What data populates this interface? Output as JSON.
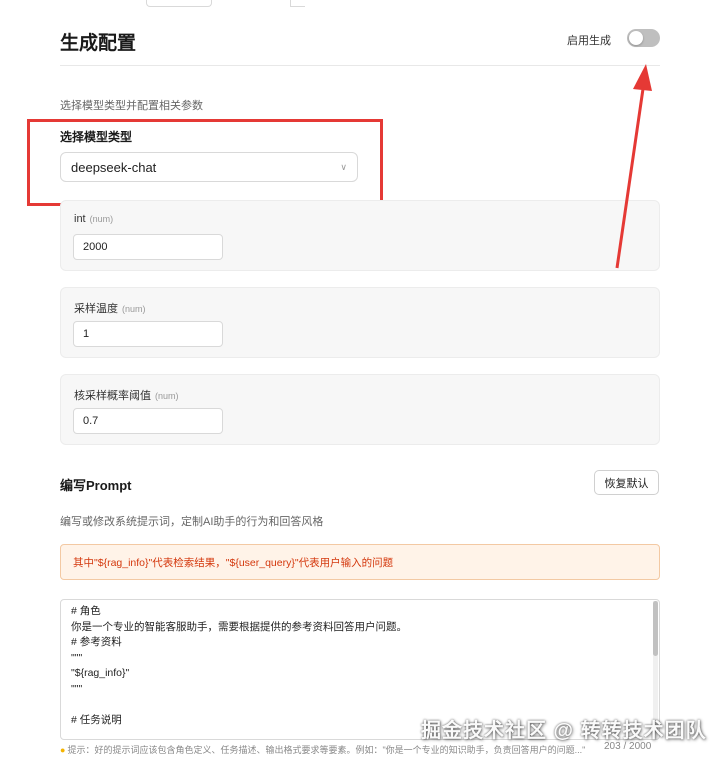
{
  "header": {
    "title": "生成配置",
    "toggle_label": "启用生成",
    "toggle_on": false
  },
  "model": {
    "description": "选择模型类型并配置相关参数",
    "select_label": "选择模型类型",
    "selected_value": "deepseek-chat"
  },
  "params": [
    {
      "name": "int",
      "unit": "(num)",
      "value": "2000"
    },
    {
      "name": "采样温度",
      "unit": "(num)",
      "value": "1"
    },
    {
      "name": "核采样概率阈值",
      "unit": "(num)",
      "value": "0.7"
    }
  ],
  "prompt": {
    "title": "编写Prompt",
    "reset_label": "恢复默认",
    "description": "编写或修改系统提示词，定制AI助手的行为和回答风格",
    "notice": "其中\"${rag_info}\"代表检索结果，\"${user_query}\"代表用户输入的问题",
    "lines": [
      "# 角色",
      "你是一个专业的智能客服助手，需要根据提供的参考资料回答用户问题。",
      "# 参考资料",
      "\"\"\"",
      "\"${rag_info}\"",
      "\"\"\"",
      "",
      "# 任务说明"
    ],
    "hint": "提示：好的提示词应该包含角色定义、任务描述、输出格式要求等要素。例如：\"你是一个专业的知识助手，负责回答用户的问题...\"",
    "counter": "203 / 2000"
  },
  "watermark": "掘金技术社区 @ 转转技术团队",
  "colors": {
    "highlight": "#e53935",
    "notice_text": "#d4380d",
    "notice_bg": "#fff3e8",
    "toggle_off": "#bfbfbf"
  }
}
